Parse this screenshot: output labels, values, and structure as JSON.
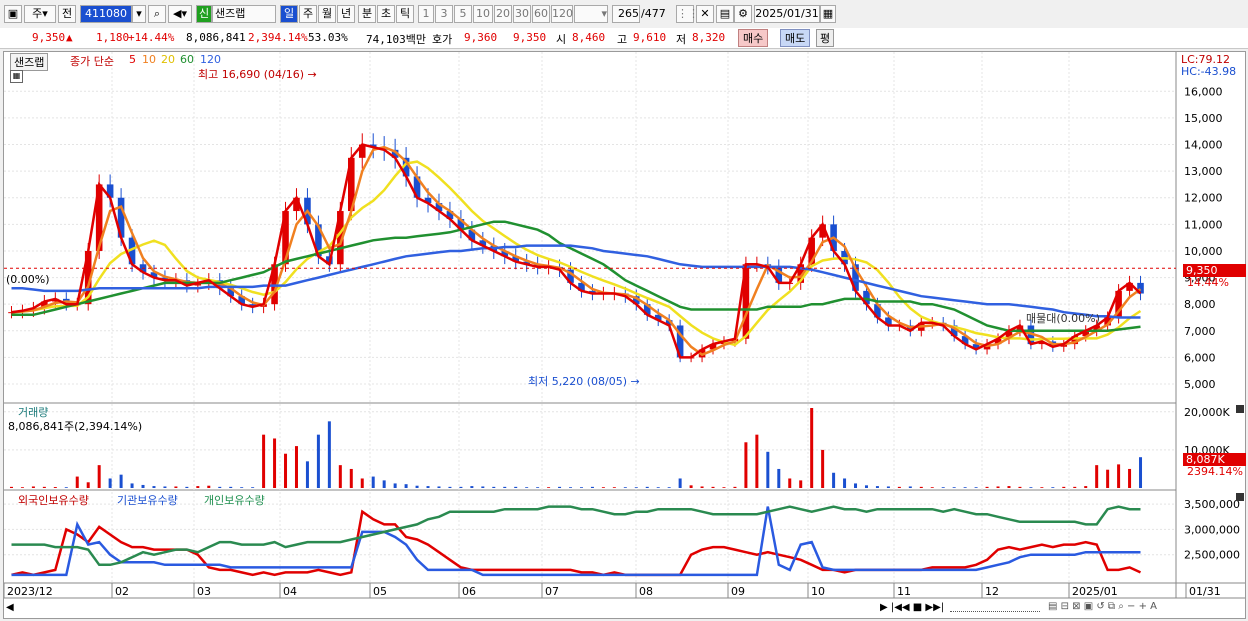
{
  "toolbar": {
    "kind": "주",
    "prev": "전",
    "code": "411080",
    "badge": "신",
    "name": "샌즈랩",
    "periods": [
      "일",
      "주",
      "월",
      "년",
      "분",
      "초",
      "틱"
    ],
    "nums": [
      "1",
      "3",
      "5",
      "10",
      "20",
      "30",
      "60",
      "120"
    ],
    "count": "265",
    "total": "/477",
    "date": "2025/01/31"
  },
  "info": {
    "price": "9,350",
    "arrow": "▲",
    "change": "1,180",
    "pct": "+14.44%",
    "volume": "8,086,841",
    "vol_pct": "2,394.14%",
    "turn": "53.03%",
    "amount": "74,103백만",
    "hoga_label": "호가",
    "hoga_bid": "9,360",
    "hoga_ask": "9,350",
    "open_label": "시",
    "open": "8,460",
    "high_label": "고",
    "high": "9,610",
    "low_label": "저",
    "low": "8,320",
    "buy": "매수",
    "sell": "매도",
    "eval": "평"
  },
  "price_panel": {
    "tab": "샌즈랩",
    "legend_title": "종가 단순",
    "ma": [
      "5",
      "10",
      "20",
      "60",
      "120"
    ],
    "max_label": "최고 16,690 (04/16)",
    "min_label": "최저 5,220 (08/05)",
    "lc": "LC:79.12",
    "hc": "HC:-43.98",
    "left_pct": "(0.00%)",
    "flag": "매물대(0.00%)",
    "cur_price": "9,350",
    "cur_pct": "14.44%",
    "y_ticks": [
      "16,000",
      "15,000",
      "14,000",
      "13,000",
      "12,000",
      "11,000",
      "10,000",
      "9,000",
      "8,000",
      "7,000",
      "6,000",
      "5,000"
    ]
  },
  "volume_panel": {
    "title": "거래량",
    "value": "8,086,841주(2,394.14%)",
    "ticks": [
      "20,000K",
      "10,000K"
    ],
    "cur": "8,087K",
    "cur_pct": "2394.14%"
  },
  "holding_panel": {
    "s1": "외국인보유수량",
    "s2": "기관보유수량",
    "s3": "개인보유수량",
    "ticks": [
      "3,500,000",
      "3,000,000",
      "2,500,000"
    ]
  },
  "x_axis": [
    "2023/12",
    "02",
    "03",
    "04",
    "05",
    "06",
    "07",
    "08",
    "09",
    "10",
    "11",
    "12",
    "2025/01",
    "01/31"
  ],
  "colors": {
    "up": "#e00000",
    "down": "#1a4fd0",
    "ma5": "#e00000",
    "ma10": "#f08020",
    "ma20": "#f0e020",
    "ma60": "#209030",
    "ma120": "#3060e0"
  },
  "chart_data": [
    {
      "type": "line",
      "title": "샌즈랩 일봉",
      "ylim": [
        4700,
        16800
      ],
      "series": [
        {
          "name": "5",
          "values": [
            7700,
            7750,
            7850,
            8100,
            8200,
            8000,
            8000,
            10000,
            12500,
            12000,
            10500,
            9500,
            9200,
            9000,
            8900,
            8900,
            8700,
            8800,
            8900,
            8600,
            8300,
            8000,
            7900,
            8000,
            9500,
            11500,
            12000,
            11000,
            9800,
            9500,
            11500,
            13500,
            14000,
            13900,
            13800,
            13500,
            12800,
            12000,
            11800,
            11500,
            11200,
            10800,
            10400,
            10200,
            10000,
            9800,
            9600,
            9500,
            9400,
            9400,
            9300,
            8800,
            8500,
            8400,
            8400,
            8400,
            8300,
            8000,
            7600,
            7400,
            7200,
            6000,
            6000,
            6300,
            6500,
            6600,
            6700,
            9500,
            9500,
            9400,
            8800,
            8800,
            9500,
            10500,
            11000,
            10000,
            9500,
            8500,
            8000,
            7500,
            7200,
            7200,
            7000,
            7300,
            7300,
            7200,
            6800,
            6500,
            6300,
            6500,
            6700,
            7000,
            7200,
            6500,
            6600,
            6400,
            6500,
            6800,
            7000,
            7200,
            7500,
            8500,
            8800,
            8400
          ]
        },
        {
          "name": "60",
          "values": [
            7600,
            7600,
            7600,
            7700,
            7800,
            7900,
            8000,
            8100,
            8200,
            8300,
            8400,
            8500,
            8600,
            8700,
            8800,
            8800,
            8800,
            8800,
            8800,
            8800,
            8900,
            9000,
            9100,
            9200,
            9400,
            9600,
            9700,
            9800,
            9900,
            10000,
            10100,
            10200,
            10300,
            10400,
            10450,
            10500,
            10500,
            10550,
            10600,
            10650,
            10700,
            10800,
            10900,
            11000,
            11100,
            11100,
            11000,
            10900,
            10800,
            10600,
            10300,
            10100,
            9900,
            9700,
            9500,
            9200,
            8900,
            8700,
            8500,
            8300,
            8100,
            7900,
            7800,
            7800,
            7800,
            7800,
            7800,
            7800,
            7800,
            7900,
            7900,
            7900,
            7900,
            8000,
            8000,
            8100,
            8200,
            8200,
            8200,
            8100,
            8100,
            8100,
            8100,
            8000,
            8000,
            7900,
            7800,
            7600,
            7400,
            7200,
            7100,
            7000,
            7000,
            7000,
            7000,
            7000,
            7000,
            7000,
            7000,
            7000,
            7000,
            7050,
            7100,
            7150
          ]
        },
        {
          "name": "120",
          "values": [
            8600,
            8600,
            8550,
            8500,
            8500,
            8500,
            8500,
            8550,
            8600,
            8600,
            8600,
            8600,
            8600,
            8600,
            8600,
            8600,
            8600,
            8600,
            8650,
            8650,
            8650,
            8650,
            8650,
            8700,
            8700,
            8700,
            8800,
            8900,
            9000,
            9100,
            9200,
            9300,
            9400,
            9500,
            9600,
            9700,
            9800,
            9850,
            9900,
            9950,
            10000,
            10000,
            10050,
            10100,
            10100,
            10150,
            10150,
            10200,
            10200,
            10200,
            10200,
            10200,
            10150,
            10100,
            10000,
            9950,
            9900,
            9850,
            9800,
            9700,
            9600,
            9500,
            9450,
            9400,
            9400,
            9400,
            9400,
            9400,
            9400,
            9400,
            9400,
            9400,
            9350,
            9300,
            9200,
            9100,
            9000,
            8900,
            8800,
            8700,
            8600,
            8500,
            8400,
            8300,
            8250,
            8200,
            8150,
            8100,
            8050,
            8000,
            8000,
            8000,
            7950,
            7900,
            7850,
            7800,
            7700,
            7650,
            7600,
            7550,
            7550,
            7500,
            7500,
            7500
          ]
        }
      ]
    },
    {
      "type": "bar",
      "title": "거래량",
      "ylim": [
        0,
        21000
      ],
      "values": [
        300,
        200,
        400,
        300,
        250,
        200,
        3000,
        1500,
        6000,
        2500,
        3500,
        1200,
        800,
        500,
        400,
        400,
        300,
        500,
        600,
        300,
        300,
        200,
        200,
        14000,
        13000,
        9000,
        11000,
        7000,
        14000,
        17500,
        6000,
        5000,
        2500,
        3000,
        2000,
        1200,
        1000,
        600,
        500,
        400,
        300,
        300,
        500,
        400,
        300,
        300,
        300,
        200,
        200,
        200,
        300,
        200,
        200,
        300,
        200,
        200,
        200,
        200,
        300,
        200,
        200,
        2500,
        700,
        400,
        300,
        200,
        300,
        12000,
        14000,
        9500,
        5000,
        2500,
        2000,
        21000,
        10000,
        4000,
        2500,
        1200,
        700,
        500,
        400,
        300,
        400,
        300,
        200,
        200,
        200,
        200,
        200,
        300,
        400,
        500,
        300,
        200,
        200,
        200,
        300,
        300,
        500,
        6000,
        4800,
        6200,
        5000,
        8087
      ]
    },
    {
      "type": "line",
      "title": "보유수량",
      "ylim": [
        2000000,
        3700000
      ],
      "series": [
        {
          "name": "외국인보유수량",
          "values": [
            2100000,
            2150000,
            2100000,
            2150000,
            2200000,
            3000000,
            2900000,
            2750000,
            3050000,
            2900000,
            2750000,
            2650000,
            2650000,
            2600000,
            2600000,
            2600000,
            2600000,
            2500000,
            2250000,
            2200000,
            2200000,
            2150000,
            2100000,
            2150000,
            2100000,
            2150000,
            2150000,
            2150000,
            2200000,
            2150000,
            2100000,
            2150000,
            3350000,
            3200000,
            3100000,
            3100000,
            2850000,
            2800000,
            2700000,
            2550000,
            2400000,
            2250000,
            2200000,
            2200000,
            2200000,
            2200000,
            2200000,
            2200000,
            2200000,
            2200000,
            2200000,
            2200000,
            2150000,
            2150000,
            2100000,
            2150000,
            2100000,
            2100000,
            2100000,
            2100000,
            2100000,
            2100000,
            2500000,
            2600000,
            2650000,
            2650000,
            2600000,
            2550000,
            2500000,
            2550000,
            2500000,
            2450000,
            2400000,
            2300000,
            2200000,
            2200000,
            2150000,
            2200000,
            2200000,
            2200000,
            2200000,
            2200000,
            2200000,
            2200000,
            2250000,
            2250000,
            2250000,
            2250000,
            2300000,
            2400000,
            2600000,
            2650000,
            2600000,
            2650000,
            2700000,
            2650000,
            2700000,
            2700000,
            2750000,
            2700000,
            2200000,
            2200000,
            2250000,
            2150000
          ]
        },
        {
          "name": "기관보유수량",
          "values": [
            2100000,
            2100000,
            2100000,
            2100000,
            2100000,
            2100000,
            3100000,
            2700000,
            2750000,
            2500000,
            2350000,
            2350000,
            2350000,
            2350000,
            2300000,
            2300000,
            2300000,
            2300000,
            2300000,
            2300000,
            2250000,
            2250000,
            2250000,
            2250000,
            2250000,
            2250000,
            2250000,
            2250000,
            2250000,
            2250000,
            2250000,
            2250000,
            2950000,
            2950000,
            2950000,
            2850000,
            2700000,
            2400000,
            2200000,
            2200000,
            2200000,
            2200000,
            2200000,
            2100000,
            2100000,
            2100000,
            2100000,
            2100000,
            2100000,
            2100000,
            2100000,
            2100000,
            2100000,
            2100000,
            2100000,
            2100000,
            2100000,
            2100000,
            2100000,
            2100000,
            2100000,
            2100000,
            2100000,
            2100000,
            2100000,
            2100000,
            2100000,
            2100000,
            2100000,
            3450000,
            2300000,
            2200000,
            2700000,
            2750000,
            2250000,
            2200000,
            2200000,
            2200000,
            2200000,
            2200000,
            2200000,
            2200000,
            2200000,
            2200000,
            2200000,
            2200000,
            2200000,
            2200000,
            2200000,
            2250000,
            2300000,
            2350000,
            2450000,
            2500000,
            2500000,
            2500000,
            2500000,
            2500000,
            2550000,
            2550000,
            2550000,
            2550000,
            2550000,
            2550000
          ]
        },
        {
          "name": "개인보유수량",
          "values": [
            2700000,
            2700000,
            2700000,
            2700000,
            2650000,
            2650000,
            2650000,
            2600000,
            2300000,
            2300000,
            2350000,
            2450000,
            2550000,
            2500000,
            2550000,
            2600000,
            2600000,
            2550000,
            2650000,
            2750000,
            2750000,
            2700000,
            2700000,
            2700000,
            2750000,
            2650000,
            2700000,
            2750000,
            2750000,
            2750000,
            2750000,
            2800000,
            2850000,
            2900000,
            2950000,
            3000000,
            3050000,
            3100000,
            3200000,
            3250000,
            3350000,
            3350000,
            3350000,
            3350000,
            3350000,
            3400000,
            3400000,
            3400000,
            3400000,
            3450000,
            3450000,
            3450000,
            3400000,
            3400000,
            3350000,
            3300000,
            3300000,
            3350000,
            3350000,
            3400000,
            3400000,
            3400000,
            3400000,
            3350000,
            3300000,
            3300000,
            3300000,
            3300000,
            3300000,
            3350000,
            3400000,
            3450000,
            3400000,
            3350000,
            3400000,
            3450000,
            3400000,
            3400000,
            3350000,
            3400000,
            3400000,
            3400000,
            3400000,
            3400000,
            3400000,
            3350000,
            3400000,
            3350000,
            3300000,
            3300000,
            3250000,
            3200000,
            3150000,
            3150000,
            3150000,
            3150000,
            3150000,
            3150000,
            3100000,
            3100000,
            3400000,
            3450000,
            3400000,
            3400000
          ]
        }
      ]
    }
  ]
}
